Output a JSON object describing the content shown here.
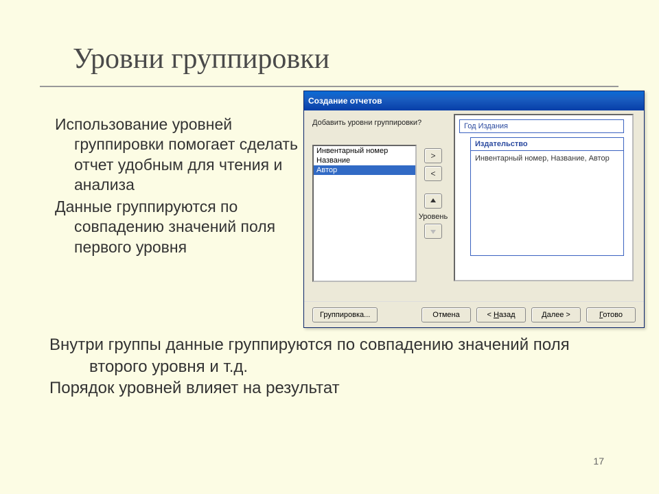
{
  "slide": {
    "title": "Уровни группировки",
    "para1": "Использование уровней группировки помогает сделать отчет удобным для чтения и анализа",
    "para2": "Данные группируются по совпадению значений поля первого уровня",
    "para3": "Внутри группы данные группируются по совпадению значений поля второго уровня и т.д.",
    "para4": "Порядок уровней влияет на результат",
    "page_number": "17"
  },
  "dialog": {
    "title": "Создание отчетов",
    "prompt": "Добавить уровни группировки?",
    "fields": [
      "Инвентарный номер",
      "Название",
      "Автор"
    ],
    "selected_field_index": 2,
    "level_label": "Уровень",
    "preview": {
      "level1": "Год Издания",
      "level2_header": "Издательство",
      "level2_detail": "Инвентарный номер, Название, Автор"
    },
    "buttons": {
      "add": ">",
      "remove": "<",
      "up": "▲",
      "down": "▼",
      "grouping": "Группировка...",
      "cancel": "Отмена",
      "back": "< Назад",
      "next": "Далее >",
      "finish": "Готово"
    }
  }
}
